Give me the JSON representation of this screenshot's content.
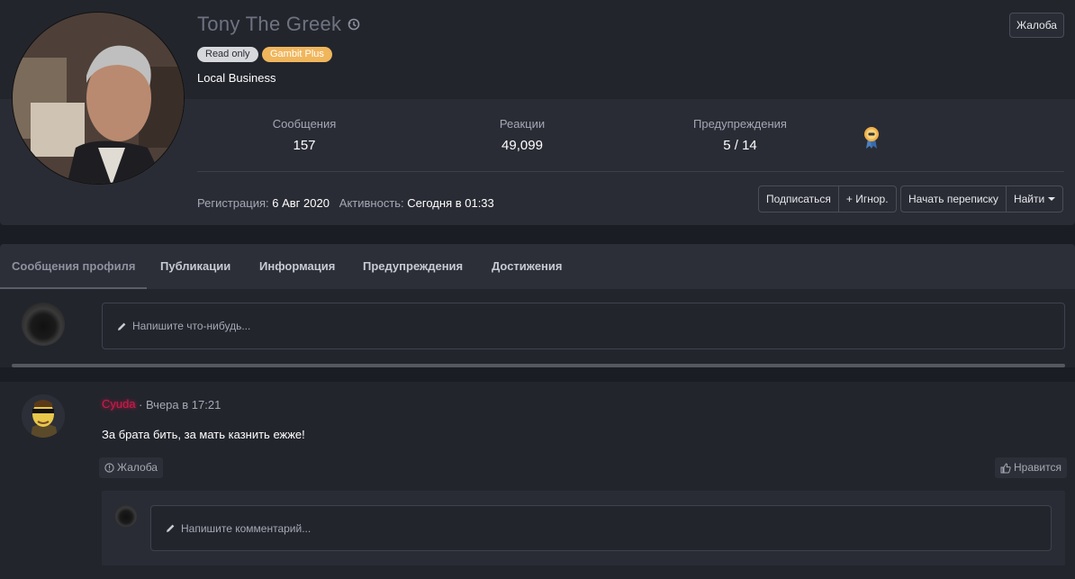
{
  "profile": {
    "username": "Tony The Greek",
    "badges": {
      "read_only": "Read only",
      "gambit_plus": "Gambit Plus"
    },
    "user_title": "Local Business",
    "report_button": "Жалоба",
    "stats": {
      "messages_label": "Сообщения",
      "messages_value": "157",
      "reactions_label": "Реакции",
      "reactions_value": "49,099",
      "warnings_label": "Предупреждения",
      "warnings_value": "5 / 14"
    },
    "registration_label": "Регистрация:",
    "registration_value": "6 Авг 2020",
    "activity_label": "Активность:",
    "activity_value": "Сегодня в 01:33",
    "actions": {
      "follow": "Подписаться",
      "ignore": "+ Игнор.",
      "start_conversation": "Начать переписку",
      "find": "Найти"
    }
  },
  "tabs": [
    {
      "label": "Сообщения профиля",
      "active": true
    },
    {
      "label": "Публикации",
      "active": false
    },
    {
      "label": "Информация",
      "active": false
    },
    {
      "label": "Предупреждения",
      "active": false
    },
    {
      "label": "Достижения",
      "active": false
    }
  ],
  "composer": {
    "placeholder": "Напишите что-нибудь..."
  },
  "post": {
    "author": "Cyuda",
    "time": "· Вчера в 17:21",
    "body": "За брата бить, за мать казнить ежже!",
    "report_label": "Жалоба",
    "like_label": "Нравится",
    "comment_placeholder": "Напишите комментарий..."
  },
  "colors": {
    "author": "#d01a4a",
    "badge_gambit": "#f0b65c",
    "badge_readonly": "#d6d8dc"
  },
  "icons": [
    "history-icon",
    "trophy-medal-icon",
    "pencil-icon",
    "report-icon",
    "thumbs-up-icon",
    "caret-down-icon"
  ]
}
